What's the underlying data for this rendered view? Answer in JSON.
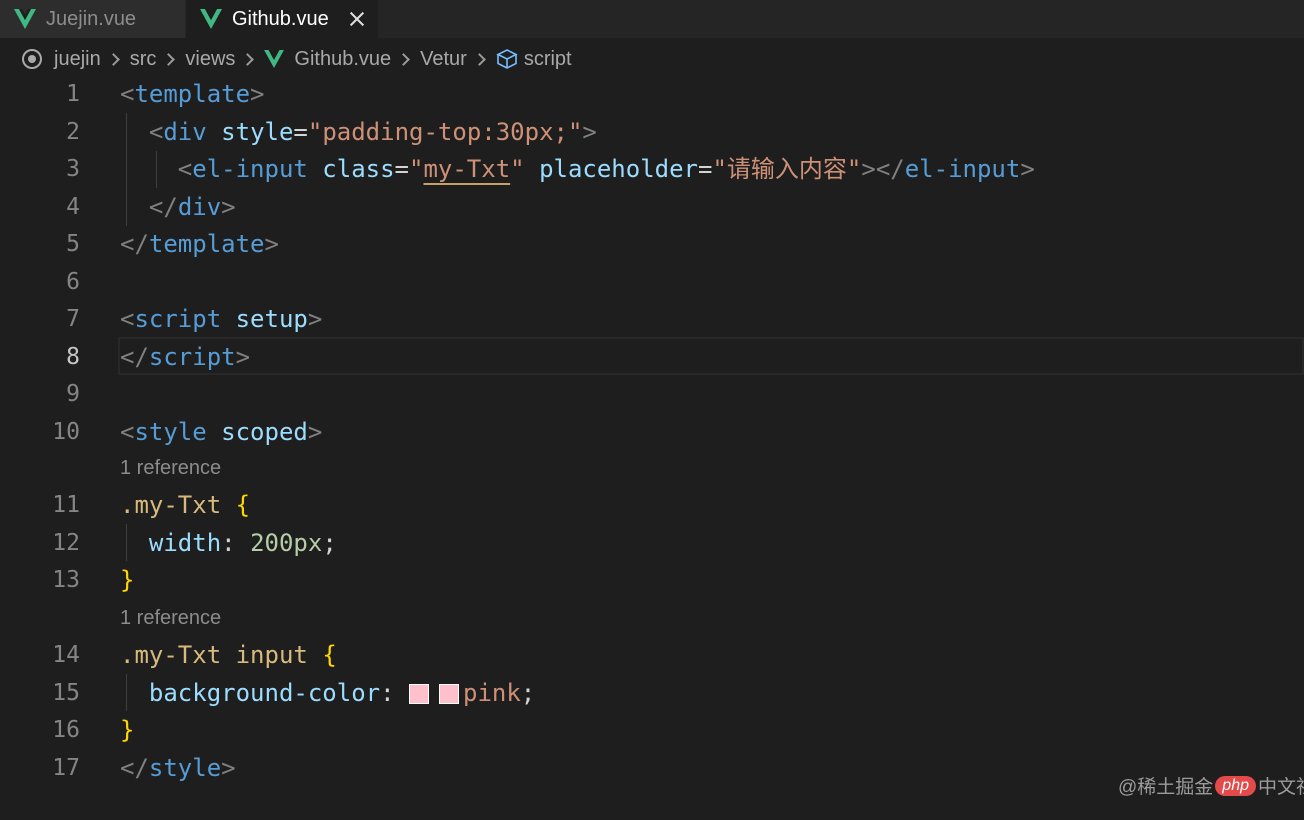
{
  "tabs": [
    {
      "label": "Juejin.vue",
      "active": false
    },
    {
      "label": "Github.vue",
      "active": true
    }
  ],
  "breadcrumb": [
    "juejin",
    "src",
    "views",
    "Github.vue",
    "Vetur",
    "script"
  ],
  "editor": {
    "current_line": "8",
    "codelens": "1 reference",
    "line_numbers": [
      "1",
      "2",
      "3",
      "4",
      "5",
      "6",
      "7",
      "8",
      "9",
      "10",
      "11",
      "12",
      "13",
      "14",
      "15",
      "16",
      "17"
    ],
    "code": {
      "l1": {
        "lt": "<",
        "tag": "template",
        "gt": ">"
      },
      "l2": {
        "lt": "<",
        "tag": "div",
        "attr": "style",
        "eq": "=",
        "val": "\"padding-top:30px;\"",
        "gt": ">"
      },
      "l3": {
        "lt": "<",
        "tag": "el-input",
        "attr1": "class",
        "eq1": "=",
        "q1": "\"",
        "val1": "my-Txt",
        "q2": "\"",
        "attr2": "placeholder",
        "eq2": "=",
        "val2": "\"请输入内容\"",
        "mid": "></",
        "tag2": "el-input",
        "gt": ">"
      },
      "l4": {
        "lt": "</",
        "tag": "div",
        "gt": ">"
      },
      "l5": {
        "lt": "</",
        "tag": "template",
        "gt": ">"
      },
      "l7": {
        "lt": "<",
        "tag": "script",
        "attr": "setup",
        "gt": ">"
      },
      "l8": {
        "lt": "</",
        "tag": "script",
        "gt": ">"
      },
      "l10": {
        "lt": "<",
        "tag": "style",
        "attr": "scoped",
        "gt": ">"
      },
      "l11": {
        "sel": ".my-Txt",
        "brace": "{"
      },
      "l12": {
        "prop": "width",
        "colon": ":",
        "val": "200px",
        "semi": ";"
      },
      "l13": {
        "brace": "}"
      },
      "l14": {
        "sel": ".my-Txt",
        "sel2": "input",
        "brace": "{"
      },
      "l15": {
        "prop": "background-color",
        "colon": ":",
        "val": "pink",
        "semi": ";"
      },
      "l16": {
        "brace": "}"
      },
      "l17": {
        "lt": "</",
        "tag": "style",
        "gt": ">"
      }
    }
  },
  "colors": {
    "swatch": "#ffc0cb",
    "background": "#1e1e1e",
    "vue_green": "#41b883"
  },
  "watermark": {
    "prefix": "@稀土掘金",
    "badge": "php",
    "suffix": "中文社区"
  }
}
